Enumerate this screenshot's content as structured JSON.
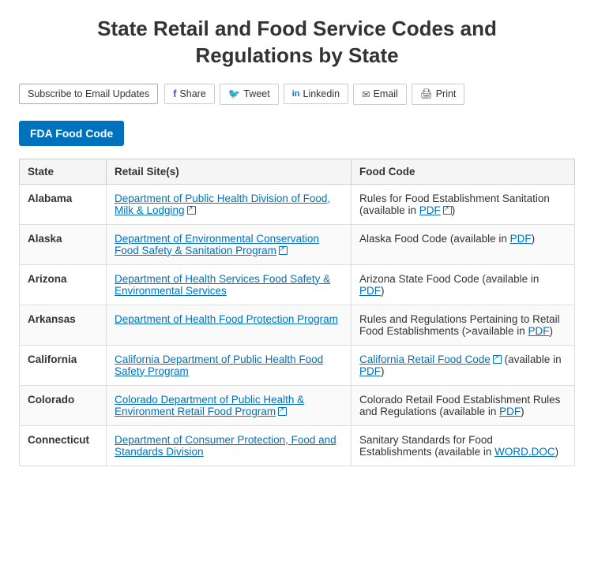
{
  "page": {
    "title_line1": "State Retail and Food Service Codes and",
    "title_line2": "Regulations by State"
  },
  "toolbar": {
    "subscribe_label": "Subscribe to Email Updates",
    "share_label": "Share",
    "tweet_label": "Tweet",
    "linkedin_label": "Linkedin",
    "email_label": "Email",
    "print_label": "Print"
  },
  "fda_button": {
    "label": "FDA Food Code"
  },
  "table": {
    "headers": [
      "State",
      "Retail Site(s)",
      "Food Code"
    ],
    "rows": [
      {
        "state": "Alabama",
        "retail_link_text": "Department of Public Health Division of Food, Milk & Lodging",
        "retail_external": true,
        "food_code_text": "Rules for Food Establishment Sanitation (available in ",
        "food_code_link": "PDF",
        "food_code_after": ")",
        "food_code_link_external": true
      },
      {
        "state": "Alaska",
        "retail_link_text": "Department of Environmental Conservation Food Safety & Sanitation Program",
        "retail_external": true,
        "food_code_text": "Alaska Food Code (available in ",
        "food_code_link": "PDF",
        "food_code_after": ")",
        "food_code_link_external": false
      },
      {
        "state": "Arizona",
        "retail_link_text": "Department of Health Services Food Safety & Environmental Services",
        "retail_external": false,
        "food_code_text": "Arizona State Food Code (available in ",
        "food_code_link": "PDF",
        "food_code_after": ")",
        "food_code_link_external": false
      },
      {
        "state": "Arkansas",
        "retail_link_text": "Department of Health Food Protection Program",
        "retail_external": false,
        "food_code_text": "Rules and Regulations Pertaining to Retail Food Establishments (>available in ",
        "food_code_link": "PDF",
        "food_code_after": ")",
        "food_code_link_external": false
      },
      {
        "state": "California",
        "retail_link_text": "California Department of Public Health Food Safety Program",
        "retail_external": false,
        "food_code_link_main": "California Retail Food Code",
        "food_code_link_main_external": true,
        "food_code_text": " (available in ",
        "food_code_link": "PDF",
        "food_code_after": ")",
        "food_code_link_external": false
      },
      {
        "state": "Colorado",
        "retail_link_text": "Colorado Department of Public Health & Environment Retail Food Program",
        "retail_external": true,
        "food_code_text": "Colorado Retail Food Establishment Rules and Regulations (available in ",
        "food_code_link": "PDF",
        "food_code_after": ")",
        "food_code_link_external": false
      },
      {
        "state": "Connecticut",
        "retail_link_text": "Department of Consumer Protection, Food and Standards Division",
        "retail_external": false,
        "food_code_text": "Sanitary Standards for Food Establishments (available in ",
        "food_code_link": "WORD.DOC",
        "food_code_after": ")",
        "food_code_link_external": false
      }
    ]
  }
}
